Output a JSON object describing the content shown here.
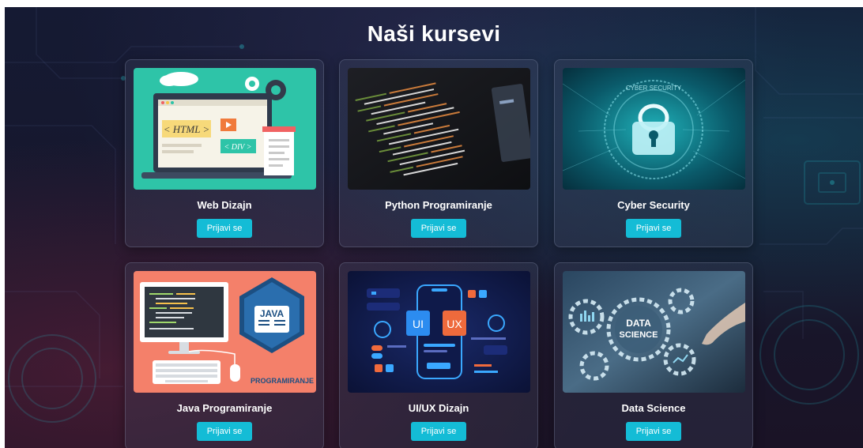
{
  "page": {
    "title": "Naši kursevi"
  },
  "courses": [
    {
      "name": "Web Dizajn",
      "button": "Prijavi se",
      "image_icon": "web-design-illustration",
      "image_text": {
        "html": "< HTML >",
        "div": "< DIV >"
      }
    },
    {
      "name": "Python Programiranje",
      "button": "Prijavi se",
      "image_icon": "code-screen-photo"
    },
    {
      "name": "Cyber Security",
      "button": "Prijavi se",
      "image_icon": "padlock-hologram",
      "image_text": {
        "ring": "CYBER SECURITY"
      }
    },
    {
      "name": "Java Programiranje",
      "button": "Prijavi se",
      "image_icon": "java-computer-illustration",
      "image_text": {
        "java": "JAVA",
        "programiranje": "PROGRAMIRANJE"
      }
    },
    {
      "name": "UI/UX Dizajn",
      "button": "Prijavi se",
      "image_icon": "ui-ux-phone-illustration",
      "image_text": {
        "ui": "UI",
        "ux": "UX"
      }
    },
    {
      "name": "Data Science",
      "button": "Prijavi se",
      "image_icon": "data-science-gears",
      "image_text": {
        "data": "DATA",
        "science": "SCIENCE"
      }
    }
  ],
  "colors": {
    "accent": "#14bcd6",
    "background": "#151a33"
  }
}
